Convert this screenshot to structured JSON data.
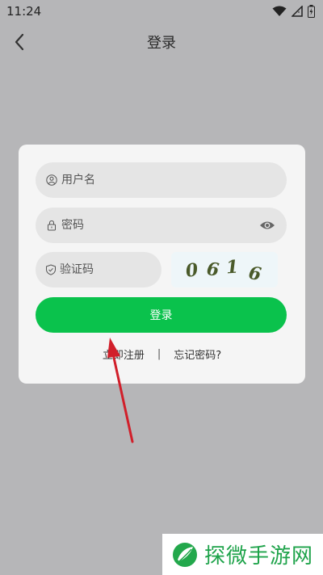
{
  "status_bar": {
    "time": "11:24",
    "icons": [
      "wifi-icon",
      "cell-signal-icon",
      "battery-charging-icon"
    ]
  },
  "nav": {
    "title": "登录",
    "back_icon": "chevron-left-icon"
  },
  "login_form": {
    "username_placeholder": "用户名",
    "password_placeholder": "密码",
    "captcha_placeholder": "验证码",
    "captcha_code": [
      "0",
      "6",
      "1",
      "6"
    ],
    "login_button": "登录",
    "register_link": "立即注册",
    "separator": "|",
    "forgot_link": "忘记密码?"
  },
  "watermark": {
    "text": "探微手游网"
  },
  "colors": {
    "accent": "#0ac24c",
    "overlay": "#b6b6b8",
    "dialog": "#f5f5f5",
    "field": "#e5e5e5",
    "annotation_arrow": "#d11f2a",
    "watermark_text": "#1ea34a"
  }
}
